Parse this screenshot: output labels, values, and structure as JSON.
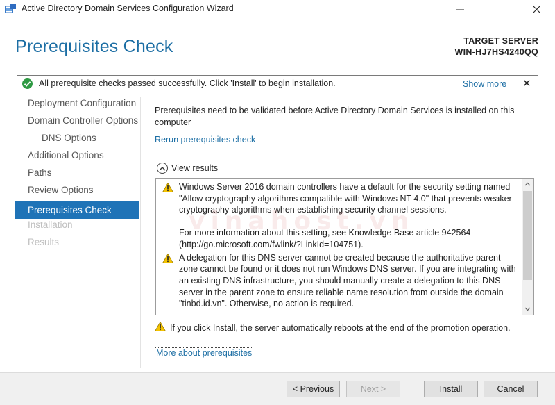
{
  "window": {
    "title": "Active Directory Domain Services Configuration Wizard",
    "minimize_glyph": "—",
    "maximize_glyph": "☐",
    "close_glyph": "✕"
  },
  "header": {
    "page_title": "Prerequisites Check",
    "target_label": "TARGET SERVER",
    "target_name": "WIN-HJ7HS4240QQ"
  },
  "notification": {
    "text": "All prerequisite checks passed successfully.  Click 'Install' to begin installation.",
    "show_more": "Show more",
    "close_glyph": "✕",
    "status_color": "#2e9a43"
  },
  "nav": {
    "items": [
      {
        "label": "Deployment Configuration",
        "state": "normal"
      },
      {
        "label": "Domain Controller Options",
        "state": "normal"
      },
      {
        "label": "DNS Options",
        "state": "sub"
      },
      {
        "label": "Additional Options",
        "state": "normal"
      },
      {
        "label": "Paths",
        "state": "normal"
      },
      {
        "label": "Review Options",
        "state": "normal"
      },
      {
        "label": "Prerequisites Check",
        "state": "active"
      },
      {
        "label": "Installation",
        "state": "disabled"
      },
      {
        "label": "Results",
        "state": "disabled"
      }
    ]
  },
  "main": {
    "intro": "Prerequisites need to be validated before Active Directory Domain Services is installed on this computer",
    "rerun_link": "Rerun prerequisites check",
    "view_results": "View results",
    "results": [
      {
        "icon": "warning-icon",
        "paragraphs": [
          "Windows Server 2016 domain controllers have a default for the security setting named \"Allow cryptography algorithms compatible with Windows NT 4.0\" that prevents weaker cryptography algorithms when establishing security channel sessions.",
          "For more information about this setting, see Knowledge Base article 942564 (http://go.microsoft.com/fwlink/?LinkId=104751)."
        ]
      },
      {
        "icon": "warning-icon",
        "paragraphs": [
          "A delegation for this DNS server cannot be created because the authoritative parent zone cannot be found or it does not run Windows DNS server. If you are integrating with an existing DNS infrastructure, you should manually create a delegation to this DNS server in the parent zone to ensure reliable name resolution from outside the domain \"tinbd.id.vn\". Otherwise, no action is required."
        ]
      }
    ],
    "reboot_warning": "If you click Install, the server automatically reboots at the end of the promotion operation.",
    "more_link": "More about prerequisites"
  },
  "footer": {
    "previous_label": "< Previous",
    "next_label": "Next >",
    "install_label": "Install",
    "cancel_label": "Cancel"
  },
  "watermark": "vinahost.vn",
  "colors": {
    "title_blue": "#1c6ea4",
    "active_nav": "#1f73b7",
    "warning_yellow": "#f3c200"
  }
}
